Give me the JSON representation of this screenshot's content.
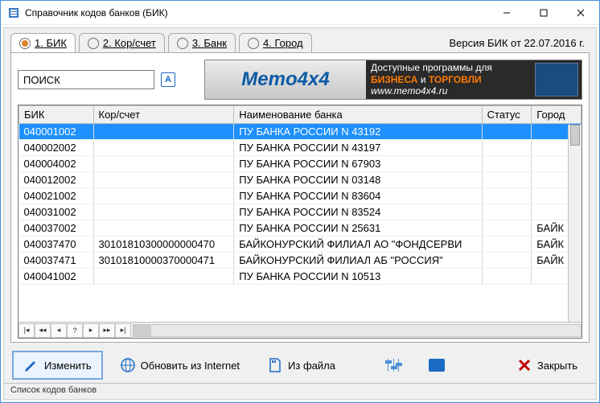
{
  "window": {
    "title": "Справочник кодов банков (БИК)"
  },
  "tabs": [
    {
      "label": "1. БИК",
      "active": true
    },
    {
      "label": "2. Кор/счет",
      "active": false
    },
    {
      "label": "3. Банк",
      "active": false
    },
    {
      "label": "4. Город",
      "active": false
    }
  ],
  "version": "Версия БИК от 22.07.2016 г.",
  "search": {
    "value": "ПОИСК",
    "lang_toggle": "А"
  },
  "banner": {
    "logo": "Memo4x4",
    "line1_pre": "Доступные программы для",
    "line1_b1": "БИЗНЕСА",
    "line1_mid": " и ",
    "line1_b2": "ТОРГОВЛИ",
    "url": "www.memo4x4.ru"
  },
  "columns": {
    "bik": "БИК",
    "kor": "Кор/счет",
    "name": "Наименование банка",
    "status": "Статус",
    "city": "Город"
  },
  "rows": [
    {
      "bik": "040001002",
      "kor": "",
      "name": "ПУ БАНКА РОССИИ N 43192",
      "status": "",
      "city": "",
      "selected": true
    },
    {
      "bik": "040002002",
      "kor": "",
      "name": "ПУ БАНКА РОССИИ N 43197",
      "status": "",
      "city": ""
    },
    {
      "bik": "040004002",
      "kor": "",
      "name": "ПУ БАНКА РОССИИ N 67903",
      "status": "",
      "city": ""
    },
    {
      "bik": "040012002",
      "kor": "",
      "name": "ПУ БАНКА РОССИИ N 03148",
      "status": "",
      "city": ""
    },
    {
      "bik": "040021002",
      "kor": "",
      "name": "ПУ БАНКА РОССИИ N 83604",
      "status": "",
      "city": ""
    },
    {
      "bik": "040031002",
      "kor": "",
      "name": "ПУ БАНКА РОССИИ N 83524",
      "status": "",
      "city": ""
    },
    {
      "bik": "040037002",
      "kor": "",
      "name": "ПУ БАНКА РОССИИ N 25631",
      "status": "",
      "city": "БАЙК"
    },
    {
      "bik": "040037470",
      "kor": "30101810300000000470",
      "name": "БАЙКОНУРСКИЙ ФИЛИАЛ АО \"ФОНДСЕРВИ",
      "status": "",
      "city": "БАЙК"
    },
    {
      "bik": "040037471",
      "kor": "30101810000370000471",
      "name": "БАЙКОНУРСКИЙ ФИЛИАЛ АБ \"РОССИЯ\"",
      "status": "",
      "city": "БАЙК"
    },
    {
      "bik": "040041002",
      "kor": "",
      "name": "ПУ БАНКА РОССИИ N 10513",
      "status": "",
      "city": ""
    }
  ],
  "nav": {
    "first": "⏮",
    "prev_page": "◀◀",
    "prev": "◀",
    "help": "?",
    "next": "▶",
    "next_page": "▶▶",
    "last": "⏭"
  },
  "buttons": {
    "edit": "Изменить",
    "update": "Обновить из Internet",
    "file": "Из файла",
    "close": "Закрыть"
  },
  "statusbar": "Список кодов банков"
}
